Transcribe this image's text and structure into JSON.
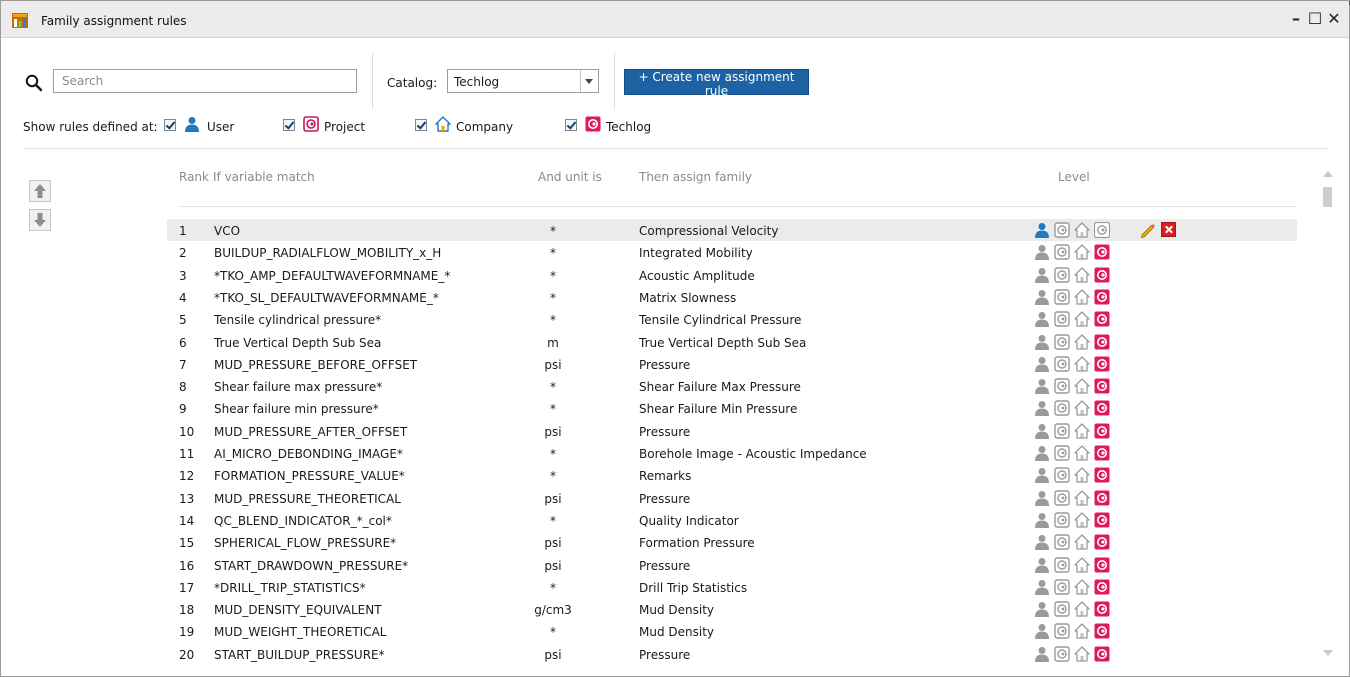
{
  "window": {
    "title": "Family assignment rules",
    "controls": [
      "–",
      "☐",
      "✕"
    ]
  },
  "search": {
    "placeholder": "Search",
    "value": ""
  },
  "catalog": {
    "label": "Catalog:",
    "selected": "Techlog"
  },
  "create_button": {
    "label": "+ Create new assignment rule"
  },
  "show_rules": {
    "label": "Show rules defined at:",
    "levels": [
      {
        "label": "User",
        "checked": true,
        "icon": "user-icon"
      },
      {
        "label": "Project",
        "checked": true,
        "icon": "project-icon"
      },
      {
        "label": "Company",
        "checked": true,
        "icon": "company-icon"
      },
      {
        "label": "Techlog",
        "checked": true,
        "icon": "techlog-icon"
      }
    ]
  },
  "columns": {
    "rank": "Rank",
    "variable": "If variable match",
    "unit": "And unit is",
    "family": "Then assign family",
    "level": "Level"
  },
  "rules": [
    {
      "rank": "1",
      "variable": "VCO",
      "unit": "*",
      "family": "Compressional Velocity",
      "level": "user",
      "selected": true
    },
    {
      "rank": "2",
      "variable": "BUILDUP_RADIALFLOW_MOBILITY_x_H",
      "unit": "*",
      "family": "Integrated Mobility",
      "level": "techlog"
    },
    {
      "rank": "3",
      "variable": "*TKO_AMP_DEFAULTWAVEFORMNAME_*",
      "unit": "*",
      "family": "Acoustic Amplitude",
      "level": "techlog"
    },
    {
      "rank": "4",
      "variable": "*TKO_SL_DEFAULTWAVEFORMNAME_*",
      "unit": "*",
      "family": "Matrix Slowness",
      "level": "techlog"
    },
    {
      "rank": "5",
      "variable": "Tensile cylindrical pressure*",
      "unit": "*",
      "family": "Tensile Cylindrical Pressure",
      "level": "techlog"
    },
    {
      "rank": "6",
      "variable": "True Vertical Depth Sub Sea",
      "unit": "m",
      "family": "True Vertical Depth Sub Sea",
      "level": "techlog"
    },
    {
      "rank": "7",
      "variable": "MUD_PRESSURE_BEFORE_OFFSET",
      "unit": "psi",
      "family": "Pressure",
      "level": "techlog"
    },
    {
      "rank": "8",
      "variable": "Shear failure max pressure*",
      "unit": "*",
      "family": "Shear Failure Max Pressure",
      "level": "techlog"
    },
    {
      "rank": "9",
      "variable": "Shear failure min pressure*",
      "unit": "*",
      "family": "Shear Failure Min Pressure",
      "level": "techlog"
    },
    {
      "rank": "10",
      "variable": "MUD_PRESSURE_AFTER_OFFSET",
      "unit": "psi",
      "family": "Pressure",
      "level": "techlog"
    },
    {
      "rank": "11",
      "variable": "AI_MICRO_DEBONDING_IMAGE*",
      "unit": "*",
      "family": "Borehole Image - Acoustic Impedance",
      "level": "techlog"
    },
    {
      "rank": "12",
      "variable": "FORMATION_PRESSURE_VALUE*",
      "unit": "*",
      "family": "Remarks",
      "level": "techlog"
    },
    {
      "rank": "13",
      "variable": "MUD_PRESSURE_THEORETICAL",
      "unit": "psi",
      "family": "Pressure",
      "level": "techlog"
    },
    {
      "rank": "14",
      "variable": "QC_BLEND_INDICATOR_*_col*",
      "unit": "*",
      "family": "Quality Indicator",
      "level": "techlog"
    },
    {
      "rank": "15",
      "variable": "SPHERICAL_FLOW_PRESSURE*",
      "unit": "psi",
      "family": "Formation Pressure",
      "level": "techlog"
    },
    {
      "rank": "16",
      "variable": "START_DRAWDOWN_PRESSURE*",
      "unit": "psi",
      "family": "Pressure",
      "level": "techlog"
    },
    {
      "rank": "17",
      "variable": "*DRILL_TRIP_STATISTICS*",
      "unit": "*",
      "family": "Drill Trip Statistics",
      "level": "techlog"
    },
    {
      "rank": "18",
      "variable": "MUD_DENSITY_EQUIVALENT",
      "unit": "g/cm3",
      "family": "Mud Density",
      "level": "techlog"
    },
    {
      "rank": "19",
      "variable": "MUD_WEIGHT_THEORETICAL",
      "unit": "*",
      "family": "Mud Density",
      "level": "techlog"
    },
    {
      "rank": "20",
      "variable": "START_BUILDUP_PRESSURE*",
      "unit": "psi",
      "family": "Pressure",
      "level": "techlog"
    }
  ],
  "colors": {
    "accent": "#1e62a6",
    "user_active": "#1e7bc3",
    "techlog_active": "#e0195a",
    "inactive": "#9a9a9a",
    "delete": "#d92027"
  }
}
